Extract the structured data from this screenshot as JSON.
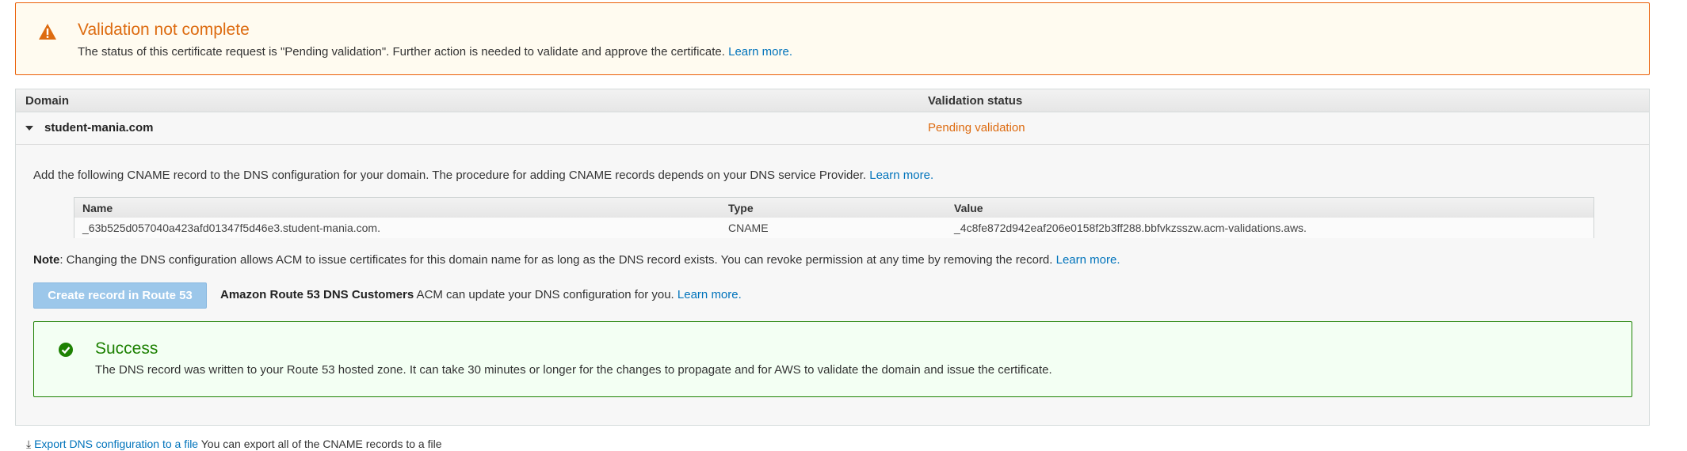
{
  "warning": {
    "title": "Validation not complete",
    "text": "The status of this certificate request is \"Pending validation\". Further action is needed to validate and approve the certificate.",
    "link": "Learn more."
  },
  "domains": {
    "headers": [
      "Domain",
      "Validation status"
    ],
    "row": {
      "name": "student-mania.com",
      "status": "Pending validation"
    }
  },
  "detail": {
    "instruction": "Add the following CNAME record to the DNS configuration for your domain. The procedure for adding CNAME records depends on your DNS service Provider.",
    "instruction_link": "Learn more.",
    "cname_headers": [
      "Name",
      "Type",
      "Value"
    ],
    "cname_row": [
      "_63b525d057040a423afd01347f5d46e3.student-mania.com.",
      "CNAME",
      "_4c8fe872d942eaf206e0158f2b3ff288.bbfvkzsszw.acm-validations.aws."
    ],
    "note_label": "Note",
    "note_text": ": Changing the DNS configuration allows ACM to issue certificates for this domain name for as long as the DNS record exists. You can revoke permission at any time by removing the record.",
    "note_link": "Learn more.",
    "create_button": "Create record in Route 53",
    "r53_bold": "Amazon Route 53 DNS Customers",
    "r53_text": " ACM can update your DNS configuration for you.",
    "r53_link": "Learn more."
  },
  "success": {
    "title": "Success",
    "text": "The DNS record was written to your Route 53 hosted zone. It can take 30 minutes or longer for the changes to propagate and for AWS to validate the domain and issue the certificate."
  },
  "bottom": {
    "link": "Export DNS configuration to a file",
    "text": " You can export all of the CNAME records to a file"
  },
  "colors": {
    "warning": "#dd6b10",
    "success": "#1d8102",
    "link": "#0073bb",
    "button": "#9cc7ea"
  },
  "icons": [
    "warning-icon",
    "caret-down-icon",
    "success-check-icon",
    "download-icon"
  ]
}
